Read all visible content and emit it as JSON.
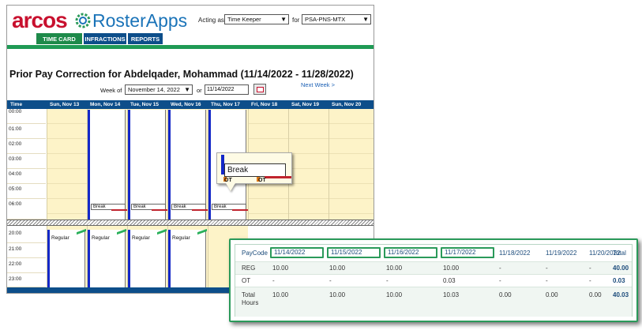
{
  "header": {
    "logo_main": "arcos",
    "logo_product": "RosterApps",
    "acting_as_label": "Acting as",
    "role_value": "Time Keeper",
    "for_label": "for",
    "org_value": "PSA-PNS-MTX"
  },
  "tabs": [
    {
      "label": "TIME CARD",
      "active": true
    },
    {
      "label": "INFRACTIONS",
      "active": false
    },
    {
      "label": "REPORTS",
      "active": false
    }
  ],
  "page": {
    "title": "Prior Pay Correction for Abdelqader, Mohammad (11/14/2022 - 11/28/2022)",
    "week_of_label": "Week of",
    "week_value": "November 14, 2022",
    "or_label": "or",
    "date_value": "11/14/2022",
    "next_week_link": "Next Week >"
  },
  "grid": {
    "columns": [
      "Time",
      "Sun, Nov 13",
      "Mon, Nov 14",
      "Tue, Nov 15",
      "Wed, Nov 16",
      "Thu, Nov 17",
      "Fri, Nov 18",
      "Sat, Nov 19",
      "Sun, Nov 20"
    ],
    "top_times": [
      "00:00",
      "01:00",
      "02:00",
      "03:00",
      "04:00",
      "05:00",
      "06:00"
    ],
    "bottom_times": [
      "20:00",
      "21:00",
      "22:00",
      "23:00"
    ],
    "break_label": "Break",
    "regular_label": "Regular"
  },
  "popup": {
    "label": "Break",
    "ot1": "OT",
    "ot2": "OT"
  },
  "totals": {
    "header": [
      "PayCode",
      "11/14/2022",
      "11/15/2022",
      "11/16/2022",
      "11/17/2022",
      "11/18/2022",
      "11/19/2022",
      "11/20/2022",
      "Total"
    ],
    "rows": [
      {
        "label": "REG",
        "values": [
          "10.00",
          "10.00",
          "10.00",
          "10.00",
          "-",
          "-",
          "-",
          "40.00"
        ]
      },
      {
        "label": "OT",
        "values": [
          "-",
          "-",
          "-",
          "0.03",
          "-",
          "-",
          "-",
          "0.03"
        ]
      },
      {
        "label": "Total Hours",
        "values": [
          "10.00",
          "10.00",
          "10.00",
          "10.03",
          "0.00",
          "0.00",
          "0.00",
          "40.03"
        ]
      }
    ]
  },
  "colors": {
    "brand_red": "#c8102e",
    "brand_blue": "#1a73b8",
    "nav_blue": "#0d4e8a",
    "active_green": "#1e8a4a",
    "grid_yellow": "#fdf3c8",
    "shift_blue": "#1428c8"
  }
}
